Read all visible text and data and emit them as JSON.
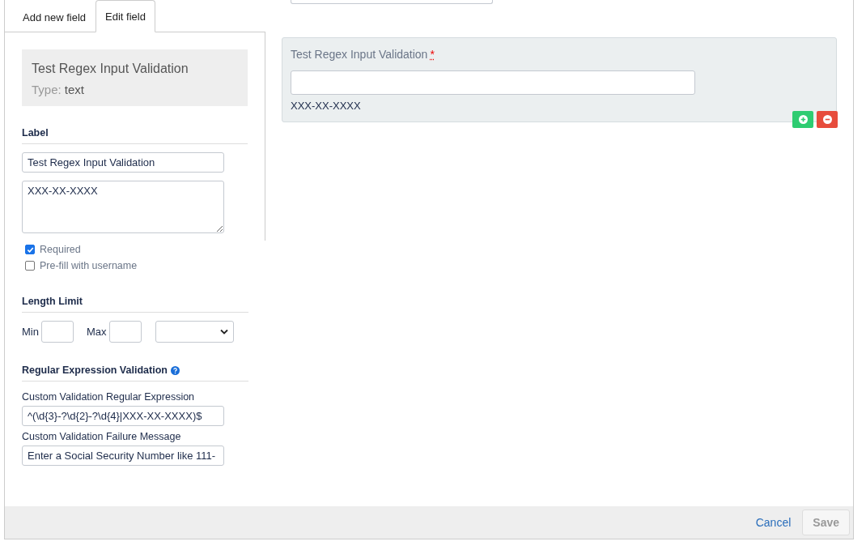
{
  "tabs": [
    {
      "label": "Add new field",
      "selected": false
    },
    {
      "label": "Edit field",
      "selected": true
    }
  ],
  "field_info": {
    "name": "Test Regex Input Validation",
    "type_label": "Type:",
    "type_value": "text"
  },
  "label_section": {
    "heading": "Label",
    "label_value": "Test Regex Input Validation",
    "help_value": "XXX-XX-XXXX",
    "options": [
      {
        "label": "Required",
        "checked": true
      },
      {
        "label": "Pre-fill with username",
        "checked": false
      }
    ]
  },
  "length_limit": {
    "heading": "Length Limit",
    "min_label": "Min",
    "max_label": "Max"
  },
  "regex_section": {
    "heading": "Regular Expression Validation",
    "regex_label": "Custom Validation Regular Expression",
    "regex_value": "^(\\d{3}-?\\d{2}-?\\d{4}|XXX-XX-XXXX)$",
    "message_label": "Custom Validation Failure Message",
    "message_value": "Enter a Social Security Number like 111-"
  },
  "preview": {
    "label": "Test Regex Input Validation",
    "required": true,
    "required_mark": "*",
    "help": "XXX-XX-XXXX"
  },
  "footer": {
    "cancel": "Cancel",
    "save": "Save",
    "save_disabled": true
  }
}
